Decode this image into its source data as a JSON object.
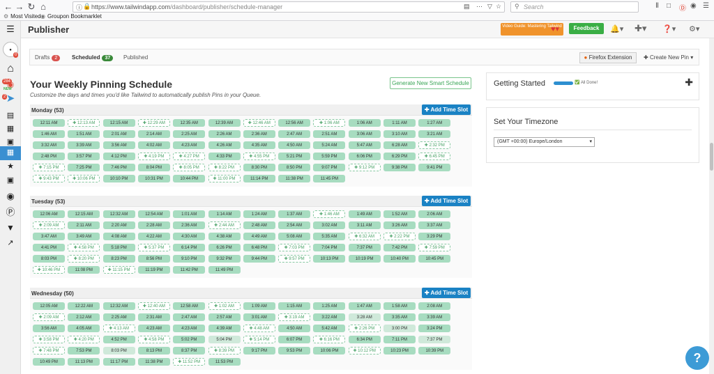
{
  "browser": {
    "url_prefix": "https://www.tailwindapp.com",
    "url_path": "/dashboard/publisher/schedule-manager",
    "search_placeholder": "Search",
    "bookmarks": [
      "Most Visited",
      "Groupon Bookmarklet"
    ]
  },
  "app": {
    "title": "Publisher",
    "video_guide": "Video Guide: Mastering Tailwind",
    "feedback": "Feedback",
    "sidebar_badges": {
      "notif1": "0",
      "notif2": "284",
      "notif3": "2"
    },
    "new_label": "NEW"
  },
  "tabs": [
    {
      "label": "Drafts",
      "count": "2",
      "color": "#d9534f"
    },
    {
      "label": "Scheduled",
      "count": "37",
      "color": "#3a8a3a"
    },
    {
      "label": "Published",
      "count": "",
      "color": ""
    }
  ],
  "toolbar": {
    "firefox_ext": "Firefox Extension",
    "create_pin": "Create New Pin"
  },
  "schedule": {
    "title": "Your Weekly Pinning Schedule",
    "subtitle": "Customize the days and times you'd like Tailwind to automatically publish Pins in your Queue.",
    "generate_btn": "Generate New Smart Schedule",
    "add_btn": "Add Time Slot",
    "days": [
      {
        "name": "Monday (53)",
        "slots": [
          [
            "12:11 AM",
            "f"
          ],
          [
            "12:13 AM",
            "e"
          ],
          [
            "12:15 AM",
            "f"
          ],
          [
            "12:29 AM",
            "e"
          ],
          [
            "12:35 AM",
            "f"
          ],
          [
            "12:39 AM",
            "f"
          ],
          [
            "12:46 AM",
            "e"
          ],
          [
            "12:56 AM",
            "f"
          ],
          [
            "1:06 AM",
            "e"
          ],
          [
            "1:06 AM",
            "f"
          ],
          [
            "1:11 AM",
            "f"
          ],
          [
            "1:27 AM",
            "f"
          ],
          [
            "1:46 AM",
            "f"
          ],
          [
            "1:51 AM",
            "f"
          ],
          [
            "2:01 AM",
            "f"
          ],
          [
            "2:14 AM",
            "f"
          ],
          [
            "2:25 AM",
            "f"
          ],
          [
            "2:26 AM",
            "f"
          ],
          [
            "2:36 AM",
            "f"
          ],
          [
            "2:47 AM",
            "f"
          ],
          [
            "2:51 AM",
            "f"
          ],
          [
            "3:06 AM",
            "f"
          ],
          [
            "3:10 AM",
            "f"
          ],
          [
            "3:21 AM",
            "f"
          ],
          [
            "3:32 AM",
            "f"
          ],
          [
            "3:39 AM",
            "f"
          ],
          [
            "3:56 AM",
            "f"
          ],
          [
            "4:02 AM",
            "f"
          ],
          [
            "4:23 AM",
            "f"
          ],
          [
            "4:26 AM",
            "f"
          ],
          [
            "4:35 AM",
            "f"
          ],
          [
            "4:50 AM",
            "f"
          ],
          [
            "5:24 AM",
            "f"
          ],
          [
            "5:47 AM",
            "f"
          ],
          [
            "6:28 AM",
            "f"
          ],
          [
            "2:32 PM",
            "e"
          ],
          [
            "2:48 PM",
            "f"
          ],
          [
            "3:57 PM",
            "f"
          ],
          [
            "4:12 PM",
            "f"
          ],
          [
            "4:19 PM",
            "e"
          ],
          [
            "4:27 PM",
            "e"
          ],
          [
            "4:33 PM",
            "f"
          ],
          [
            "4:55 PM",
            "e"
          ],
          [
            "5:21 PM",
            "f"
          ],
          [
            "5:59 PM",
            "f"
          ],
          [
            "6:06 PM",
            "f"
          ],
          [
            "6:29 PM",
            "f"
          ],
          [
            "6:45 PM",
            "e"
          ],
          [
            "7:15 PM",
            "e"
          ],
          [
            "7:25 PM",
            "f"
          ],
          [
            "7:46 PM",
            "f"
          ],
          [
            "8:04 PM",
            "f"
          ],
          [
            "8:05 PM",
            "e"
          ],
          [
            "8:22 PM",
            "e"
          ],
          [
            "8:30 PM",
            "f"
          ],
          [
            "8:50 PM",
            "f"
          ],
          [
            "9:07 PM",
            "f"
          ],
          [
            "9:12 PM",
            "e"
          ],
          [
            "9:38 PM",
            "f"
          ],
          [
            "9:41 PM",
            "f"
          ],
          [
            "9:43 PM",
            "e"
          ],
          [
            "10:06 PM",
            "e"
          ],
          [
            "10:10 PM",
            "f"
          ],
          [
            "10:31 PM",
            "f"
          ],
          [
            "10:44 PM",
            "f"
          ],
          [
            "11:00 PM",
            "e"
          ],
          [
            "11:14 PM",
            "f"
          ],
          [
            "11:38 PM",
            "f"
          ],
          [
            "11:45 PM",
            "f"
          ]
        ]
      },
      {
        "name": "Tuesday (53)",
        "slots": [
          [
            "12:06 AM",
            "f"
          ],
          [
            "12:15 AM",
            "f"
          ],
          [
            "12:32 AM",
            "f"
          ],
          [
            "12:54 AM",
            "f"
          ],
          [
            "1:01 AM",
            "f"
          ],
          [
            "1:14 AM",
            "f"
          ],
          [
            "1:24 AM",
            "f"
          ],
          [
            "1:37 AM",
            "f"
          ],
          [
            "1:46 AM",
            "e"
          ],
          [
            "1:49 AM",
            "f"
          ],
          [
            "1:52 AM",
            "f"
          ],
          [
            "2:06 AM",
            "f"
          ],
          [
            "2:09 AM",
            "e"
          ],
          [
            "2:11 AM",
            "f"
          ],
          [
            "2:20 AM",
            "f"
          ],
          [
            "2:28 AM",
            "f"
          ],
          [
            "2:36 AM",
            "f"
          ],
          [
            "2:44 AM",
            "e"
          ],
          [
            "2:48 AM",
            "f"
          ],
          [
            "2:54 AM",
            "f"
          ],
          [
            "3:02 AM",
            "f"
          ],
          [
            "3:11 AM",
            "f"
          ],
          [
            "3:26 AM",
            "f"
          ],
          [
            "3:37 AM",
            "f"
          ],
          [
            "3:47 AM",
            "f"
          ],
          [
            "3:49 AM",
            "f"
          ],
          [
            "4:08 AM",
            "f"
          ],
          [
            "4:22 AM",
            "f"
          ],
          [
            "4:30 AM",
            "f"
          ],
          [
            "4:38 AM",
            "f"
          ],
          [
            "4:49 AM",
            "f"
          ],
          [
            "5:08 AM",
            "f"
          ],
          [
            "5:35 AM",
            "f"
          ],
          [
            "6:32 AM",
            "e"
          ],
          [
            "2:22 PM",
            "e"
          ],
          [
            "3:29 PM",
            "f"
          ],
          [
            "4:41 PM",
            "f"
          ],
          [
            "4:58 PM",
            "e"
          ],
          [
            "5:18 PM",
            "f"
          ],
          [
            "5:37 PM",
            "e"
          ],
          [
            "6:14 PM",
            "f"
          ],
          [
            "6:26 PM",
            "f"
          ],
          [
            "6:48 PM",
            "f"
          ],
          [
            "7:03 PM",
            "e"
          ],
          [
            "7:04 PM",
            "f"
          ],
          [
            "7:37 PM",
            "f"
          ],
          [
            "7:42 PM",
            "f"
          ],
          [
            "7:59 PM",
            "e"
          ],
          [
            "8:03 PM",
            "f"
          ],
          [
            "8:20 PM",
            "e"
          ],
          [
            "8:23 PM",
            "f"
          ],
          [
            "8:56 PM",
            "f"
          ],
          [
            "9:10 PM",
            "f"
          ],
          [
            "9:32 PM",
            "f"
          ],
          [
            "9:44 PM",
            "f"
          ],
          [
            "9:57 PM",
            "e"
          ],
          [
            "10:13 PM",
            "f"
          ],
          [
            "10:19 PM",
            "f"
          ],
          [
            "10:40 PM",
            "f"
          ],
          [
            "10:45 PM",
            "f"
          ],
          [
            "10:46 PM",
            "e"
          ],
          [
            "11:08 PM",
            "f"
          ],
          [
            "11:15 PM",
            "e"
          ],
          [
            "11:19 PM",
            "f"
          ],
          [
            "11:42 PM",
            "f"
          ],
          [
            "11:49 PM",
            "f"
          ]
        ]
      },
      {
        "name": "Wednesday (50)",
        "slots": [
          [
            "12:05 AM",
            "f"
          ],
          [
            "12:22 AM",
            "f"
          ],
          [
            "12:32 AM",
            "f"
          ],
          [
            "12:40 AM",
            "e"
          ],
          [
            "12:58 AM",
            "f"
          ],
          [
            "1:02 AM",
            "e"
          ],
          [
            "1:09 AM",
            "f"
          ],
          [
            "1:15 AM",
            "f"
          ],
          [
            "1:25 AM",
            "f"
          ],
          [
            "1:47 AM",
            "f"
          ],
          [
            "1:58 AM",
            "f"
          ],
          [
            "2:08 AM",
            "f"
          ],
          [
            "2:09 AM",
            "e"
          ],
          [
            "2:12 AM",
            "f"
          ],
          [
            "2:25 AM",
            "f"
          ],
          [
            "2:31 AM",
            "f"
          ],
          [
            "2:47 AM",
            "f"
          ],
          [
            "2:57 AM",
            "f"
          ],
          [
            "3:01 AM",
            "f"
          ],
          [
            "3:19 AM",
            "e"
          ],
          [
            "3:22 AM",
            "f"
          ],
          [
            "3:28 AM",
            "p"
          ],
          [
            "3:35 AM",
            "f"
          ],
          [
            "3:39 AM",
            "f"
          ],
          [
            "3:56 AM",
            "f"
          ],
          [
            "4:05 AM",
            "f"
          ],
          [
            "4:13 AM",
            "e"
          ],
          [
            "4:23 AM",
            "f"
          ],
          [
            "4:23 AM",
            "f"
          ],
          [
            "4:39 AM",
            "f"
          ],
          [
            "4:48 AM",
            "e"
          ],
          [
            "4:50 AM",
            "f"
          ],
          [
            "5:42 AM",
            "f"
          ],
          [
            "2:26 PM",
            "e"
          ],
          [
            "3:00 PM",
            "p"
          ],
          [
            "3:24 PM",
            "f"
          ],
          [
            "3:58 PM",
            "e"
          ],
          [
            "4:20 PM",
            "e"
          ],
          [
            "4:52 PM",
            "f"
          ],
          [
            "4:58 PM",
            "e"
          ],
          [
            "5:02 PM",
            "f"
          ],
          [
            "5:04 PM",
            "p"
          ],
          [
            "5:14 PM",
            "e"
          ],
          [
            "6:07 PM",
            "f"
          ],
          [
            "6:16 PM",
            "e"
          ],
          [
            "6:34 PM",
            "f"
          ],
          [
            "7:11 PM",
            "f"
          ],
          [
            "7:37 PM",
            "p"
          ],
          [
            "7:48 PM",
            "e"
          ],
          [
            "7:53 PM",
            "f"
          ],
          [
            "8:03 PM",
            "p"
          ],
          [
            "8:13 PM",
            "f"
          ],
          [
            "8:37 PM",
            "f"
          ],
          [
            "8:39 PM",
            "e"
          ],
          [
            "9:17 PM",
            "f"
          ],
          [
            "9:53 PM",
            "f"
          ],
          [
            "10:06 PM",
            "f"
          ],
          [
            "10:12 PM",
            "e"
          ],
          [
            "10:23 PM",
            "f"
          ],
          [
            "10:39 PM",
            "f"
          ],
          [
            "10:49 PM",
            "f"
          ],
          [
            "11:13 PM",
            "f"
          ],
          [
            "11:17 PM",
            "f"
          ],
          [
            "11:38 PM",
            "f"
          ],
          [
            "11:52 PM",
            "e"
          ],
          [
            "11:53 PM",
            "f"
          ]
        ]
      }
    ]
  },
  "getting_started": {
    "title": "Getting Started",
    "status": "All Done!"
  },
  "timezone": {
    "title": "Set Your Timezone",
    "value": "(GMT +00:00) Europe/London"
  },
  "help": "?"
}
